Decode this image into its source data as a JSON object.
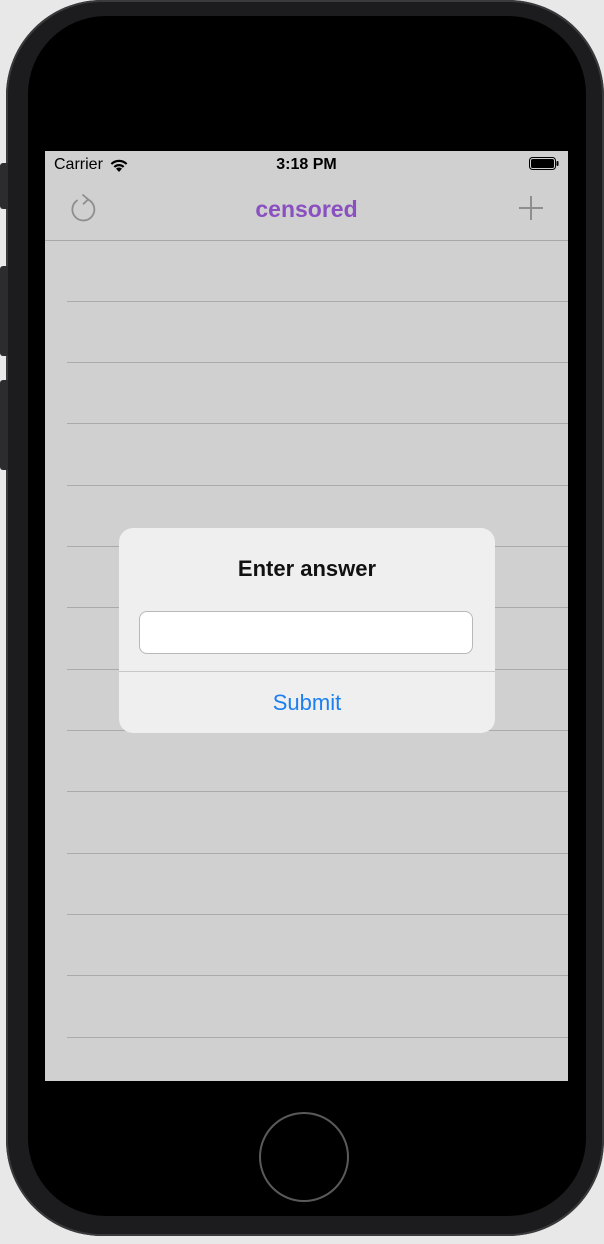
{
  "status_bar": {
    "carrier": "Carrier",
    "time": "3:18 PM",
    "wifi_icon": "wifi-icon",
    "battery_icon": "battery-icon"
  },
  "navbar": {
    "title": "censored",
    "title_color": "#8a4fc0",
    "left_button_icon": "refresh-icon",
    "right_button_icon": "plus-icon"
  },
  "table": {
    "row_count": 14
  },
  "alert": {
    "title": "Enter answer",
    "input_value": "",
    "input_placeholder": "",
    "submit_label": "Submit",
    "button_color": "#1a7ff0"
  },
  "device": {
    "home_button_icon": "home-button"
  }
}
